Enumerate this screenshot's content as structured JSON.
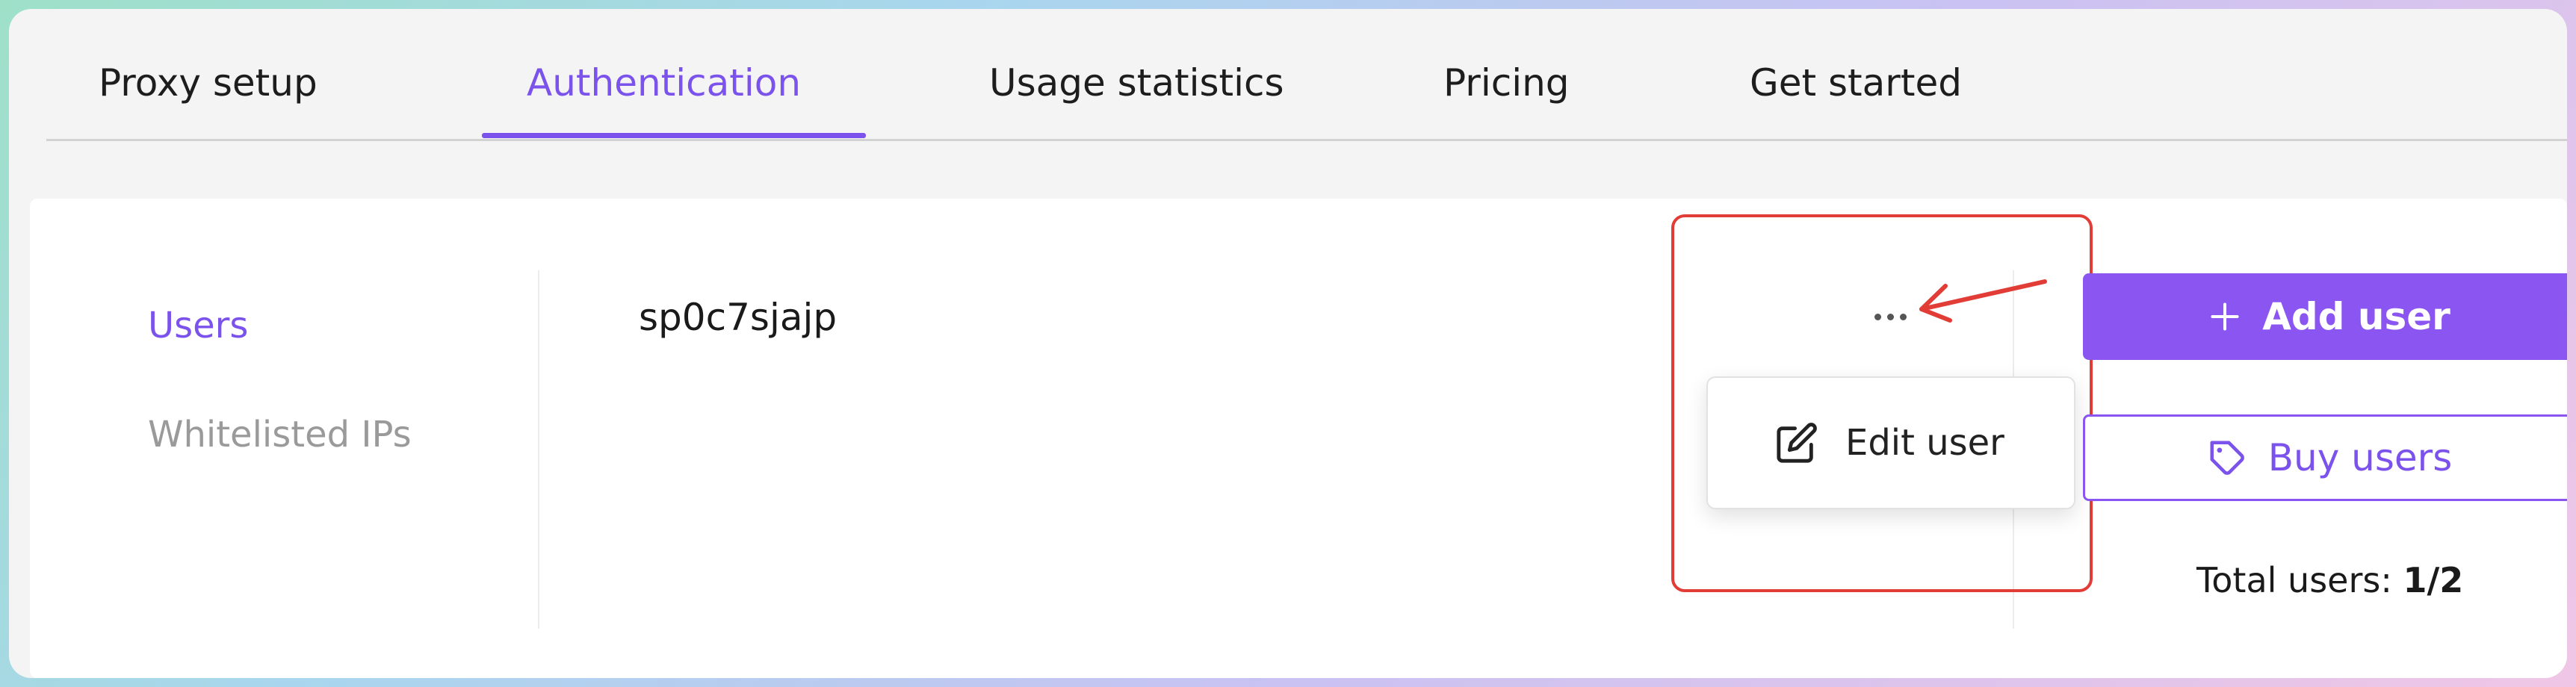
{
  "tabs": [
    {
      "label": "Proxy setup"
    },
    {
      "label": "Authentication"
    },
    {
      "label": "Usage statistics"
    },
    {
      "label": "Pricing"
    },
    {
      "label": "Get started"
    }
  ],
  "active_tab": "Authentication",
  "sidebar": {
    "items": [
      {
        "label": "Users"
      },
      {
        "label": "Whitelisted IPs"
      }
    ]
  },
  "users": {
    "rows": [
      {
        "username": "sp0c7sjajp"
      }
    ],
    "more_icon": "more-horizontal-icon",
    "menu": {
      "items": [
        {
          "label": "Edit user",
          "icon": "edit-icon"
        }
      ]
    }
  },
  "actions": {
    "add_user_label": "Add user",
    "add_user_icon": "plus-icon",
    "buy_users_label": "Buy users",
    "buy_users_icon": "tag-icon"
  },
  "total": {
    "label": "Total users:",
    "value": "1/2"
  },
  "colors": {
    "accent": "#7b52ec",
    "button": "#8a55f0",
    "annotation": "#e23c37"
  }
}
